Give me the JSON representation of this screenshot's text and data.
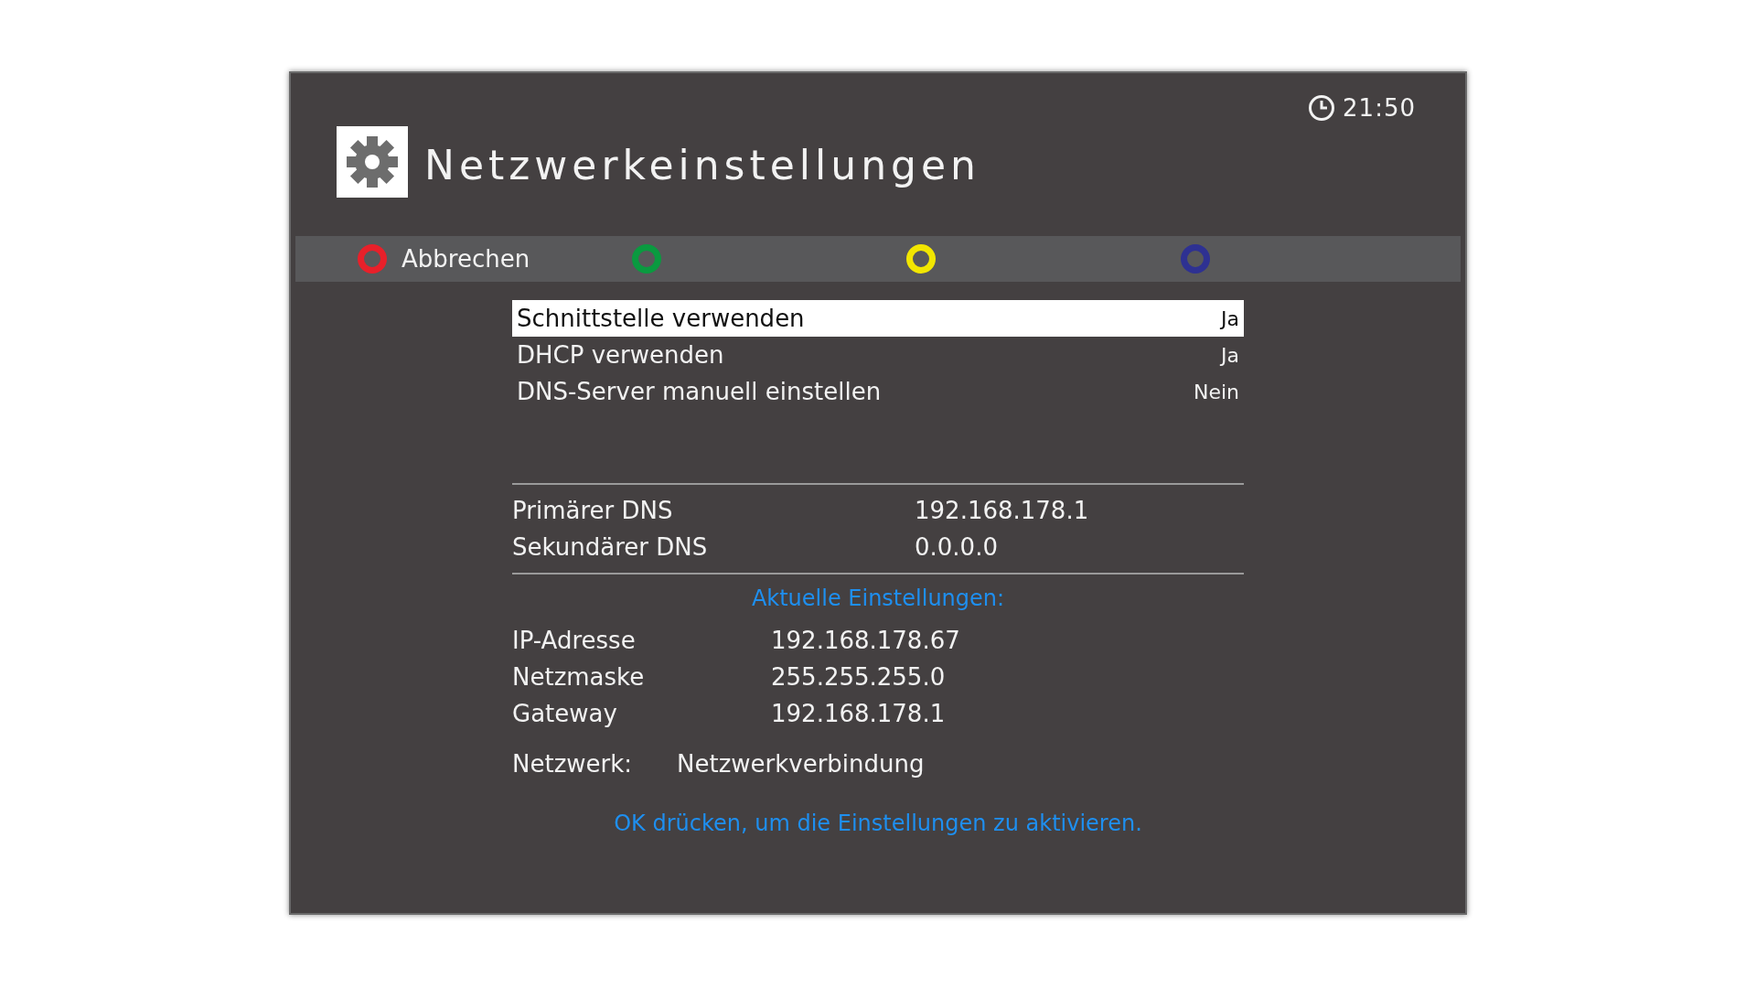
{
  "clock": {
    "time": "21:50"
  },
  "title": "Netzwerkeinstellungen",
  "color_keys": [
    {
      "color": "#e8202a",
      "label": "Abbrechen"
    },
    {
      "color": "#0a9a40"
    },
    {
      "color": "#f2e600"
    },
    {
      "color": "#2e3192"
    }
  ],
  "menu": [
    {
      "label": "Schnittstelle verwenden",
      "value": "Ja",
      "selected": true
    },
    {
      "label": "DHCP verwenden",
      "value": "Ja",
      "selected": false
    },
    {
      "label": "DNS-Server manuell einstellen",
      "value": "Nein",
      "selected": false
    }
  ],
  "dns": [
    {
      "label": "Primärer DNS",
      "value": "192.168.178.1"
    },
    {
      "label": "Sekundärer DNS",
      "value": "0.0.0.0"
    }
  ],
  "current_heading": "Aktuelle Einstellungen:",
  "current": [
    {
      "label": "IP-Adresse",
      "value": "192.168.178.67"
    },
    {
      "label": "Netzmaske",
      "value": "255.255.255.0"
    },
    {
      "label": "Gateway",
      "value": "192.168.178.1"
    }
  ],
  "network": {
    "label": "Netzwerk:",
    "value": "Netzwerkverbindung"
  },
  "hint": "OK drücken, um die Einstellungen zu aktivieren."
}
